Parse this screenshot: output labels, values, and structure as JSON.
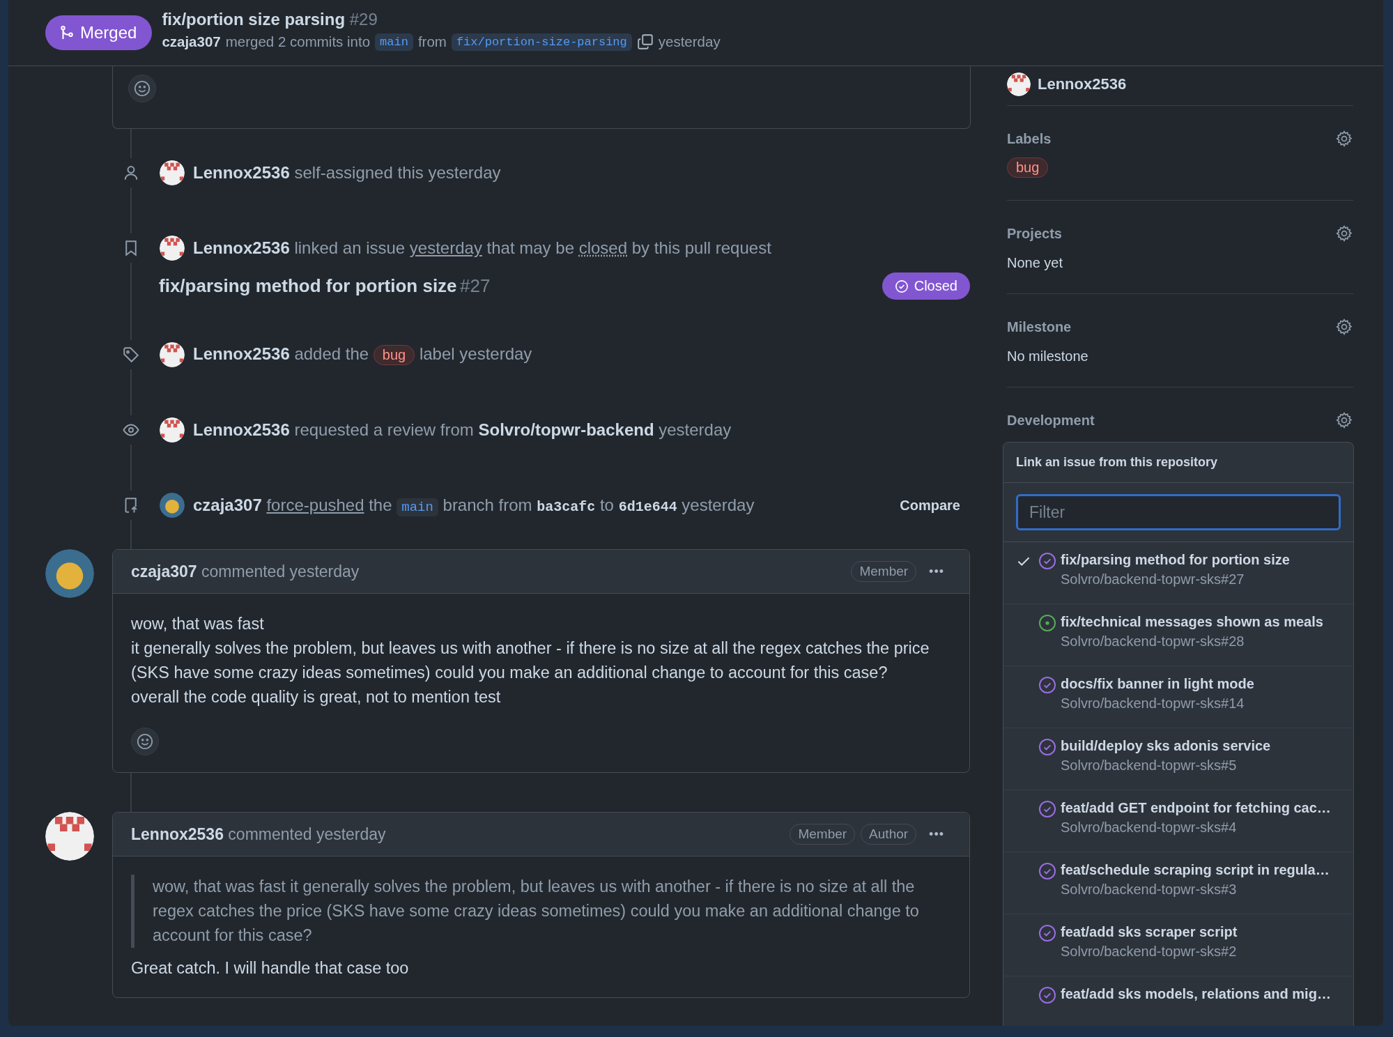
{
  "header": {
    "status": "Merged",
    "title": "fix/portion size parsing",
    "number": "#29",
    "author": "czaja307",
    "action": "merged 2 commits into",
    "base": "main",
    "from_word": "from",
    "head": "fix/portion-size-parsing",
    "time": "yesterday"
  },
  "timeline": [
    {
      "kind": "assign",
      "avatar": {
        "kind": "identicon"
      },
      "segments": [
        {
          "kind": "user",
          "text": "Lennox2536"
        },
        {
          "kind": "plain",
          "text": "self-assigned this yesterday"
        }
      ]
    },
    {
      "kind": "link",
      "avatar": {
        "kind": "identicon"
      },
      "segments": [
        {
          "kind": "user",
          "text": "Lennox2536"
        },
        {
          "kind": "plain",
          "text": "linked an issue"
        },
        {
          "kind": "link",
          "text": "yesterday"
        },
        {
          "kind": "plain",
          "text": "that may be"
        },
        {
          "kind": "dotted",
          "text": "closed"
        },
        {
          "kind": "plain",
          "text": "by this pull request"
        }
      ],
      "issue": {
        "title": "fix/parsing method for portion size",
        "number": "#27",
        "state": "Closed"
      }
    },
    {
      "kind": "label",
      "avatar": {
        "kind": "identicon"
      },
      "segments": [
        {
          "kind": "user",
          "text": "Lennox2536"
        },
        {
          "kind": "plain",
          "text": "added the"
        },
        {
          "kind": "label",
          "text": "bug"
        },
        {
          "kind": "plain",
          "text": "label yesterday"
        }
      ]
    },
    {
      "kind": "review",
      "avatar": {
        "kind": "identicon"
      },
      "segments": [
        {
          "kind": "user",
          "text": "Lennox2536"
        },
        {
          "kind": "plain",
          "text": "requested a review from"
        },
        {
          "kind": "strong",
          "text": "Solvro/topwr-backend"
        },
        {
          "kind": "plain",
          "text": "yesterday"
        }
      ]
    },
    {
      "kind": "push",
      "avatar": {
        "kind": "photo"
      },
      "segments": [
        {
          "kind": "user",
          "text": "czaja307"
        },
        {
          "kind": "link",
          "text": "force-pushed"
        },
        {
          "kind": "plain",
          "text": "the"
        },
        {
          "kind": "code",
          "text": "main"
        },
        {
          "kind": "plain",
          "text": "branch from"
        },
        {
          "kind": "sha",
          "text": "ba3cafc"
        },
        {
          "kind": "plain",
          "text": "to"
        },
        {
          "kind": "sha",
          "text": "6d1e644"
        },
        {
          "kind": "plain",
          "text": "yesterday"
        }
      ],
      "action": "Compare"
    }
  ],
  "comments": [
    {
      "avatar": {
        "kind": "photo"
      },
      "author": "czaja307",
      "time": "commented yesterday",
      "badges": [
        "Member"
      ],
      "more": "•••",
      "lines": [
        "wow, that was fast",
        "it generally solves the problem, but leaves us with another - if there is no size at all the regex catches the price (SKS have some crazy ideas sometimes) could you make an additional change to account for this case?",
        "overall the code quality is great, not to mention test"
      ],
      "reactions": true
    },
    {
      "avatar": {
        "kind": "identicon"
      },
      "author": "Lennox2536",
      "time": "commented yesterday",
      "badges": [
        "Member",
        "Author"
      ],
      "more": "•••",
      "quote": "wow, that was fast it generally solves the problem, but leaves us with another - if there is no size at all the regex catches the price (SKS have some crazy ideas sometimes) could you make an additional change to account for this case?",
      "lines": [
        "Great catch. I will handle that case too"
      ],
      "reactions": false
    }
  ],
  "sidebar": {
    "assignee": "Lennox2536",
    "sections": [
      {
        "kind": "labels",
        "title": "Labels",
        "labels": [
          "bug"
        ]
      },
      {
        "kind": "text",
        "title": "Projects",
        "value": "None yet"
      },
      {
        "kind": "text",
        "title": "Milestone",
        "value": "No milestone"
      },
      {
        "kind": "development",
        "title": "Development"
      }
    ],
    "dropdown": {
      "title": "Link an issue from this repository",
      "placeholder": "Filter",
      "items": [
        {
          "title": "fix/parsing method for portion size",
          "ref": "Solvro/backend-topwr-sks#27",
          "selected": true,
          "kind": "closed"
        },
        {
          "title": "fix/technical messages shown as meals",
          "ref": "Solvro/backend-topwr-sks#28",
          "selected": false,
          "kind": "open"
        },
        {
          "title": "docs/fix banner in light mode",
          "ref": "Solvro/backend-topwr-sks#14",
          "selected": false,
          "kind": "closed"
        },
        {
          "title": "build/deploy sks adonis service",
          "ref": "Solvro/backend-topwr-sks#5",
          "selected": false,
          "kind": "closed"
        },
        {
          "title": "feat/add GET endpoint for fetching cac…",
          "ref": "Solvro/backend-topwr-sks#4",
          "selected": false,
          "kind": "closed"
        },
        {
          "title": "feat/schedule scraping script in regula…",
          "ref": "Solvro/backend-topwr-sks#3",
          "selected": false,
          "kind": "closed"
        },
        {
          "title": "feat/add sks scraper script",
          "ref": "Solvro/backend-topwr-sks#2",
          "selected": false,
          "kind": "closed"
        },
        {
          "title": "feat/add sks models, relations and mig…",
          "selected": false,
          "kind": "closed"
        }
      ]
    }
  }
}
